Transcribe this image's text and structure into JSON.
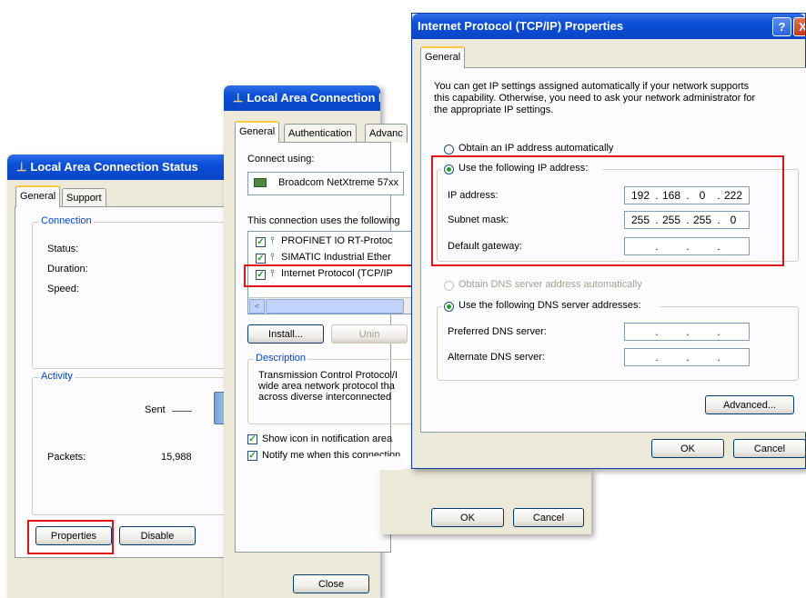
{
  "status_window": {
    "title": "Local Area Connection Status",
    "tabs": [
      "General",
      "Support"
    ],
    "connection_group": "Connection",
    "status_label": "Status:",
    "duration_label": "Duration:",
    "speed_label": "Speed:",
    "activity_group": "Activity",
    "sent_label": "Sent",
    "packets_label": "Packets:",
    "packets_value": "15,988",
    "properties_button": "Properties",
    "disable_button": "Disable",
    "close_button": "Close"
  },
  "properties_window": {
    "title": "Local Area Connection Pro",
    "tabs": [
      "General",
      "Authentication",
      "Advanc"
    ],
    "connect_using_label": "Connect using:",
    "adapter_name": "Broadcom NetXtreme 57xx",
    "items_label": "This connection uses the following",
    "items": [
      {
        "label": "PROFINET IO RT-Protoc",
        "checked": true
      },
      {
        "label": "SIMATIC Industrial Ether",
        "checked": true
      },
      {
        "label": "Internet Protocol (TCP/IP",
        "checked": true
      }
    ],
    "install_button": "Install...",
    "uninstall_button": "Unin",
    "description_group": "Description",
    "description_text": "Transmission Control Protocol/I wide area network protocol tha across diverse interconnected",
    "show_icon_label": "Show icon in notification area",
    "notify_label": "Notify me when this connection",
    "ok_button": "OK",
    "cancel_button": "Cancel"
  },
  "tcpip_window": {
    "title": "Internet Protocol (TCP/IP) Properties",
    "help_button": "?",
    "close_button": "X",
    "tab": "General",
    "intro_line1": "You can get IP settings assigned automatically if your network supports",
    "intro_line2": "this capability. Otherwise, you need to ask your network administrator for",
    "intro_line3": "the appropriate IP settings.",
    "obtain_ip_auto": "Obtain an IP address automatically",
    "use_following_ip": "Use the following IP address:",
    "ip_address_label": "IP address:",
    "ip_address": [
      "192",
      "168",
      "0",
      "222"
    ],
    "subnet_mask_label": "Subnet mask:",
    "subnet_mask": [
      "255",
      "255",
      "255",
      "0"
    ],
    "default_gateway_label": "Default gateway:",
    "obtain_dns_auto": "Obtain DNS server address automatically",
    "use_following_dns": "Use the following DNS server addresses:",
    "preferred_dns_label": "Preferred DNS server:",
    "alternate_dns_label": "Alternate DNS server:",
    "advanced_button": "Advanced...",
    "ok_button": "OK",
    "cancel_button": "Cancel"
  },
  "colors": {
    "titlebar_blue": "#0b4ed8",
    "window_face": "#ece9d8",
    "group_label_blue": "#0046d5",
    "highlight_red": "#e01414"
  }
}
